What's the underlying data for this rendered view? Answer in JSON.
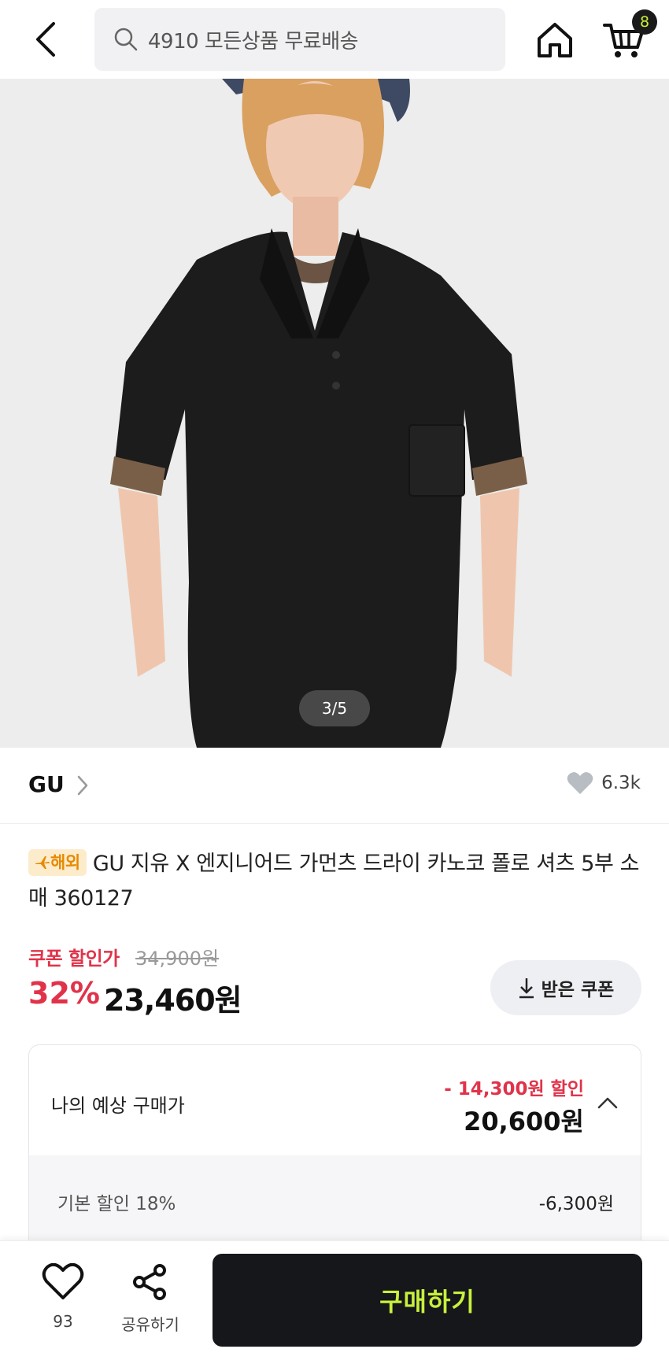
{
  "header": {
    "search_placeholder": "4910 모든상품 무료배송",
    "cart_count": "8"
  },
  "hero": {
    "page_indicator": "3/5"
  },
  "brand": {
    "name": "GU",
    "like_count": "6.3k"
  },
  "product": {
    "badge": "해외",
    "title": "GU 지유 X 엔지니어드 가먼츠 드라이 카노코 폴로 셔츠 5부 소매 360127"
  },
  "price": {
    "label": "쿠폰 할인가",
    "original": "34,900원",
    "discount_rate": "32%",
    "final": "23,460원",
    "coupon_button": "받은 쿠폰"
  },
  "estimate": {
    "label": "나의 예상 구매가",
    "discount": "- 14,300원 할인",
    "price": "20,600원",
    "basic_label": "기본 할인 18%",
    "basic_amount": "-6,300원"
  },
  "bottom": {
    "wish_count": "93",
    "share_label": "공유하기",
    "buy_label": "구매하기"
  },
  "colors": {
    "accent_red": "#e0334a",
    "buy_button_bg": "#15171a",
    "buy_button_text": "#c8f03c",
    "badge_bg": "#fdeccc",
    "badge_text": "#e68a00"
  },
  "icons": [
    "back-arrow-icon",
    "search-icon",
    "home-icon",
    "cart-icon",
    "chevron-right-icon",
    "heart-icon",
    "airplane-icon",
    "download-icon",
    "chevron-up-icon",
    "share-icon"
  ]
}
